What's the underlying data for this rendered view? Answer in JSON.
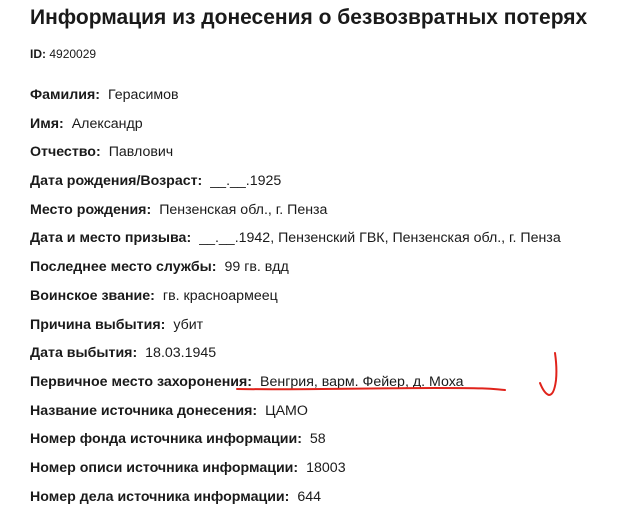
{
  "title": "Информация из донесения о безвозвратных потерях",
  "id": {
    "label": "ID:",
    "value": "4920029"
  },
  "fields": [
    {
      "label": "Фамилия:",
      "value": "Герасимов"
    },
    {
      "label": "Имя:",
      "value": "Александр"
    },
    {
      "label": "Отчество:",
      "value": "Павлович"
    },
    {
      "label": "Дата рождения/Возраст:",
      "value": "__.__.1925"
    },
    {
      "label": "Место рождения:",
      "value": "Пензенская обл., г. Пенза"
    },
    {
      "label": "Дата и место призыва:",
      "value": "__.__.1942, Пензенский ГВК, Пензенская обл., г. Пенза"
    },
    {
      "label": "Последнее место службы:",
      "value": "99 гв. вдд"
    },
    {
      "label": "Воинское звание:",
      "value": "гв. красноармеец"
    },
    {
      "label": "Причина выбытия:",
      "value": "убит"
    },
    {
      "label": "Дата выбытия:",
      "value": "18.03.1945"
    },
    {
      "label": "Первичное место захоронения:",
      "value": "Венгрия, варм. Фейер, д. Моха"
    },
    {
      "label": "Название источника донесения:",
      "value": "ЦАМО"
    },
    {
      "label": "Номер фонда источника информации:",
      "value": "58"
    },
    {
      "label": "Номер описи источника информации:",
      "value": "18003"
    },
    {
      "label": "Номер дела источника информации:",
      "value": "644"
    }
  ],
  "annotation": {
    "color": "#e0231b",
    "underline_icon": "red-underline",
    "check_icon": "red-check-mark"
  }
}
